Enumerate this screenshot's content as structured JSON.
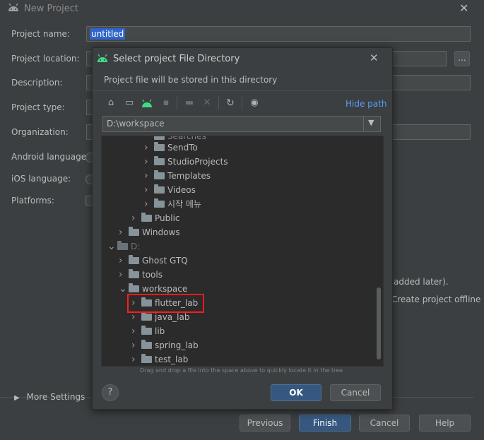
{
  "window": {
    "title": "New Project"
  },
  "form": {
    "project_name_label": "Project name:",
    "project_name_value": "untitled",
    "project_location_label": "Project location:",
    "browse_label": "...",
    "description_label": "Description:",
    "project_type_label": "Project type:",
    "organization_label": "Organization:",
    "android_language_label": "Android language:",
    "ios_language_label": "iOS language:",
    "platforms_label": "Platforms:",
    "offline_label": "Create project offline",
    "added_later_text": "added later).",
    "more_settings_label": "More Settings"
  },
  "footer": {
    "previous": "Previous",
    "finish": "Finish",
    "cancel": "Cancel",
    "help": "Help"
  },
  "dialog": {
    "title": "Select project File Directory",
    "subtitle": "Project file will be stored in this directory",
    "hide_path": "Hide path",
    "path_value": "D:\\workspace",
    "drag_hint": "Drag and drop a file into the space above to quickly locate it in the tree",
    "ok": "OK",
    "cancel": "Cancel",
    "help_glyph": "?"
  },
  "tree": {
    "partial_top": "Searches",
    "items": [
      {
        "label": "SendTo",
        "level": 3,
        "expanded": false
      },
      {
        "label": "StudioProjects",
        "level": 3,
        "expanded": false
      },
      {
        "label": "Templates",
        "level": 3,
        "expanded": false
      },
      {
        "label": "Videos",
        "level": 3,
        "expanded": false
      },
      {
        "label": "시작 메뉴",
        "level": 3,
        "expanded": false
      },
      {
        "label": "Public",
        "level": 2,
        "expanded": false
      },
      {
        "label": "Windows",
        "level": 1,
        "expanded": false
      },
      {
        "label": "D:",
        "level": 0,
        "expanded": true,
        "drive": true
      },
      {
        "label": "Ghost GTQ",
        "level": 1,
        "expanded": false
      },
      {
        "label": "tools",
        "level": 1,
        "expanded": false
      },
      {
        "label": "workspace",
        "level": 1,
        "expanded": true
      },
      {
        "label": "flutter_lab",
        "level": 2,
        "expanded": false,
        "highlighted": true
      },
      {
        "label": "java_lab",
        "level": 2,
        "expanded": false
      },
      {
        "label": "lib",
        "level": 2,
        "expanded": false
      },
      {
        "label": "spring_lab",
        "level": 2,
        "expanded": false
      },
      {
        "label": "test_lab",
        "level": 2,
        "expanded": false
      }
    ]
  },
  "colors": {
    "android": "#3ddc84",
    "highlight": "#ff1c1c",
    "link": "#589df6"
  },
  "icons": [
    "home-icon",
    "desktop-icon",
    "android-icon",
    "module-icon",
    "new-folder-icon",
    "delete-icon",
    "refresh-icon",
    "show-hidden-icon"
  ]
}
